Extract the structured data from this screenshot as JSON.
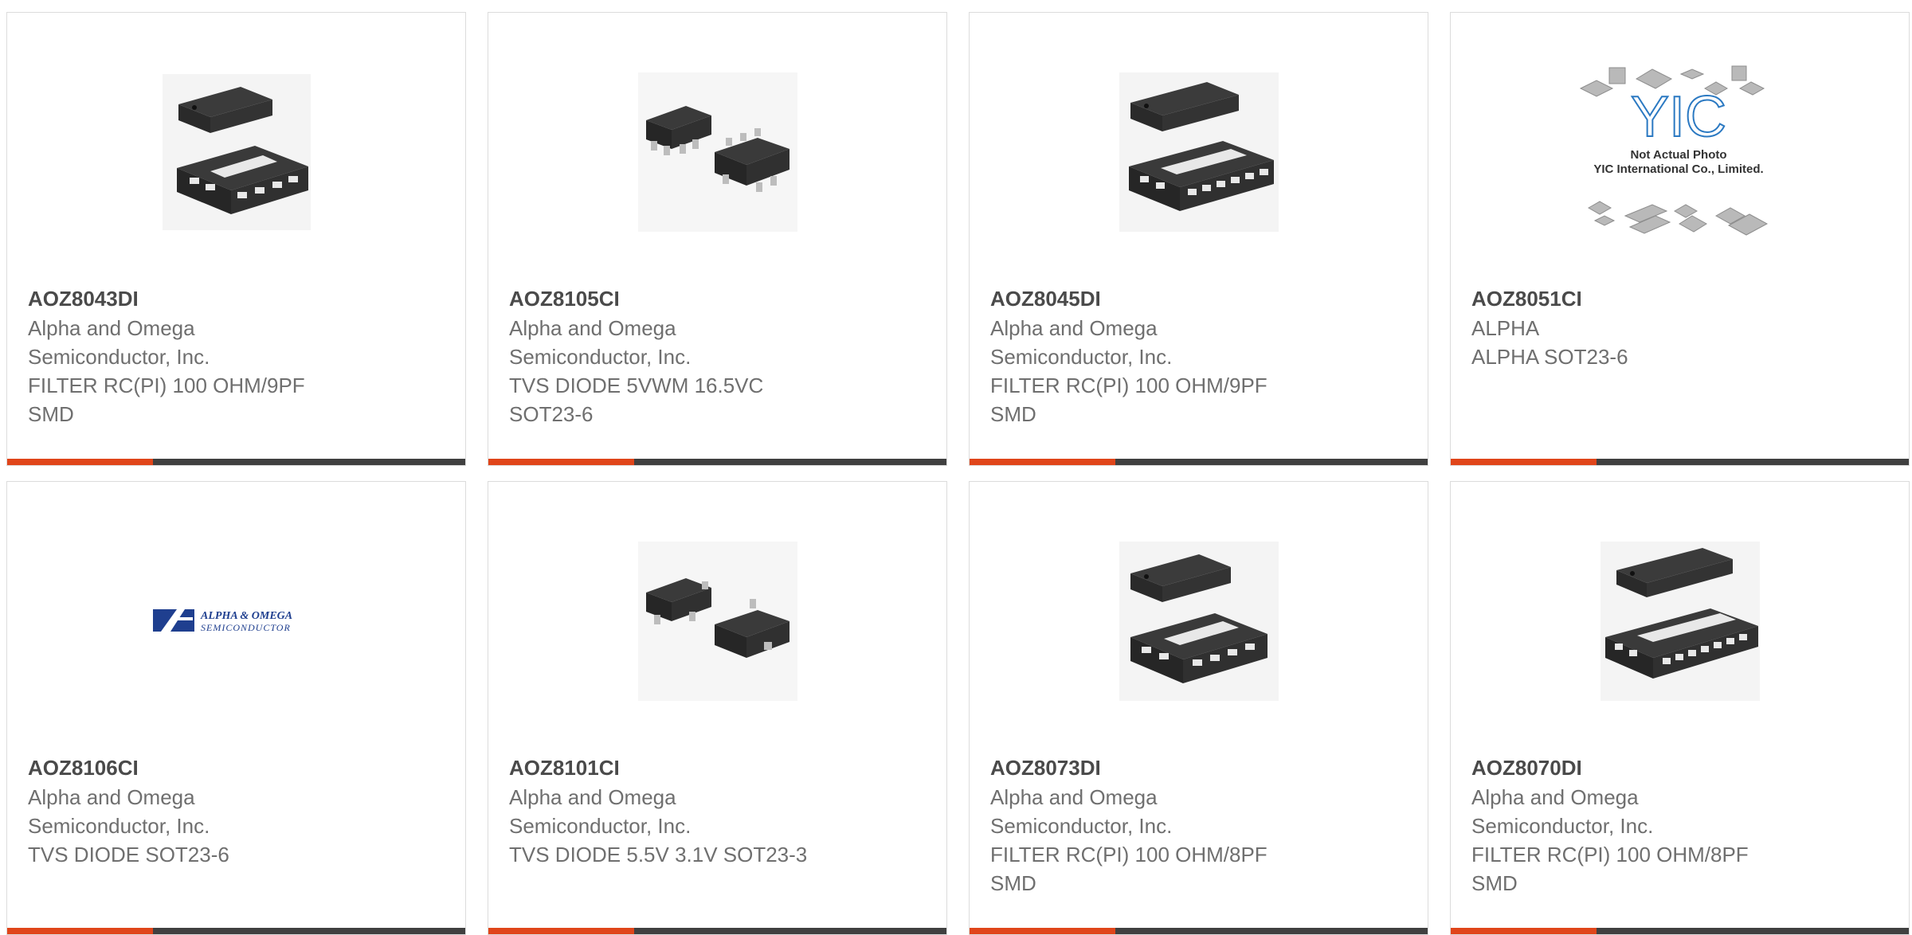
{
  "products": [
    {
      "part": "AOZ8043DI",
      "lines": [
        "Alpha and Omega",
        "Semiconductor, Inc.",
        "FILTER RC(PI) 100 OHM/9PF",
        "SMD"
      ],
      "image": "dfn-12-package-image"
    },
    {
      "part": "AOZ8105CI",
      "lines": [
        "Alpha and Omega",
        "Semiconductor, Inc.",
        "TVS DIODE 5VWM 16.5VC",
        "SOT23-6"
      ],
      "image": "sot23-6-package-image"
    },
    {
      "part": "AOZ8045DI",
      "lines": [
        "Alpha and Omega",
        "Semiconductor, Inc.",
        "FILTER RC(PI) 100 OHM/9PF",
        "SMD"
      ],
      "image": "dfn-14-package-image"
    },
    {
      "part": "AOZ8051CI",
      "lines": [
        "ALPHA",
        "ALPHA SOT23-6"
      ],
      "image": "placeholder-not-actual-photo",
      "placeholder_logo": "YIC",
      "placeholder_line1": "Not Actual Photo",
      "placeholder_line2": "YIC International Co., Limited."
    },
    {
      "part": "AOZ8106CI",
      "lines": [
        "Alpha and Omega",
        "Semiconductor, Inc.",
        "TVS DIODE SOT23-6"
      ],
      "image": "manufacturer-logo",
      "logo_line1": "ALPHA & OMEGA",
      "logo_line2": "SEMICONDUCTOR"
    },
    {
      "part": "AOZ8101CI",
      "lines": [
        "Alpha and Omega",
        "Semiconductor, Inc.",
        "TVS DIODE 5.5V 3.1V SOT23-3"
      ],
      "image": "sot23-3-package-image"
    },
    {
      "part": "AOZ8073DI",
      "lines": [
        "Alpha and Omega",
        "Semiconductor, Inc.",
        "FILTER RC(PI) 100 OHM/8PF",
        "SMD"
      ],
      "image": "dfn-12-package-image"
    },
    {
      "part": "AOZ8070DI",
      "lines": [
        "Alpha and Omega",
        "Semiconductor, Inc.",
        "FILTER RC(PI) 100 OHM/8PF",
        "SMD"
      ],
      "image": "dfn-16-package-image"
    }
  ],
  "colors": {
    "accent": "#e0451a",
    "bar": "#404040",
    "border": "#dcdcdc",
    "title": "#4a4a4a",
    "text": "#6f6f6f"
  }
}
